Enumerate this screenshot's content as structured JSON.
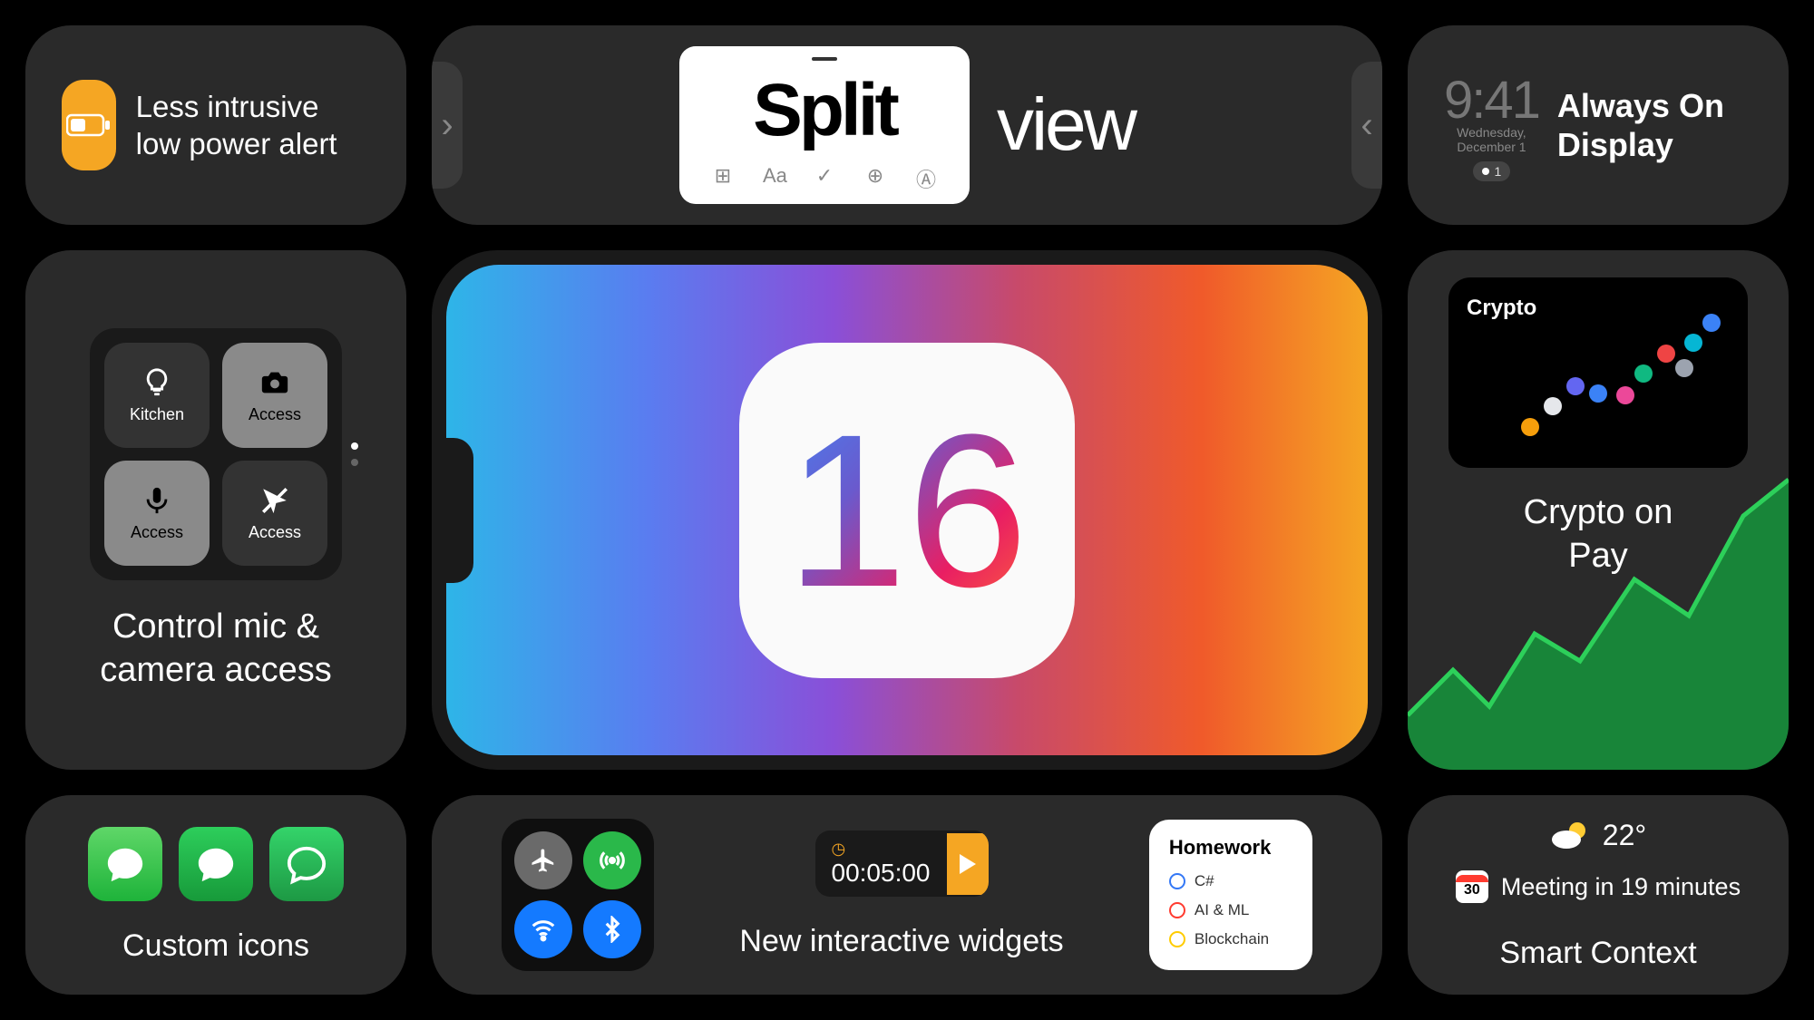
{
  "low_power": {
    "text": "Less intrusive low power alert"
  },
  "split_view": {
    "bold": "Split",
    "light": "view",
    "toolbar": {
      "a": "⊞",
      "b": "Aa",
      "c": "✓",
      "d": "⊕",
      "e": "Ⓐ"
    }
  },
  "aod": {
    "time": "9:41",
    "date": "Wednesday, December 1",
    "badge": "1",
    "label": "Always On Display"
  },
  "control": {
    "tiles": [
      {
        "label": "Kitchen"
      },
      {
        "label": "Access"
      },
      {
        "label": "Access"
      },
      {
        "label": "Access"
      }
    ],
    "caption": "Control mic & camera access"
  },
  "phone": {
    "os_number": "16"
  },
  "crypto": {
    "widget_title": "Crypto",
    "caption_line1": "Crypto on",
    "caption_line2": " Pay"
  },
  "custom_icons": {
    "caption": "Custom icons"
  },
  "interactive": {
    "timer": "00:05:00",
    "caption": "New interactive widgets",
    "homework": {
      "title": "Homework",
      "items": [
        "C#",
        "AI & ML",
        "Blockchain"
      ]
    }
  },
  "smart_context": {
    "temp": "22°",
    "cal_day": "30",
    "meeting": "Meeting in 19 minutes",
    "caption": "Smart Context"
  }
}
